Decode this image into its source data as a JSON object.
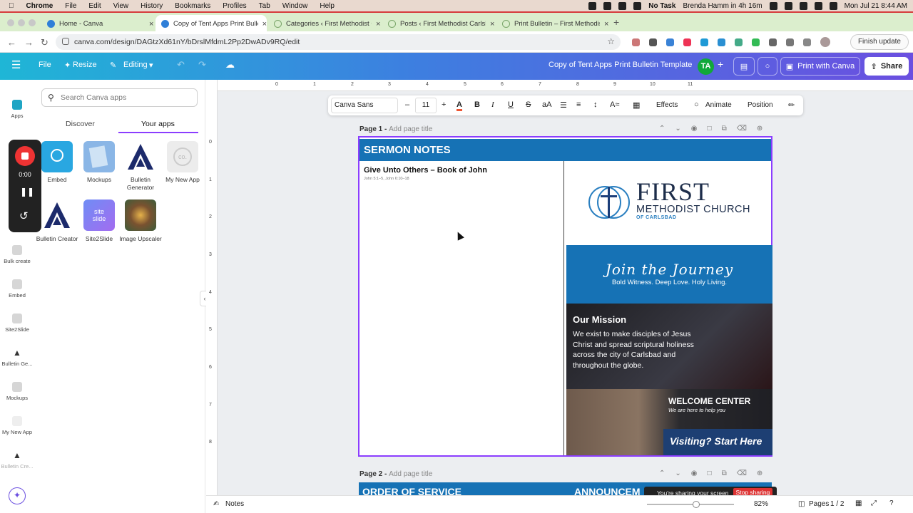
{
  "menubar": {
    "app": "Chrome",
    "items": [
      "File",
      "Edit",
      "View",
      "History",
      "Bookmarks",
      "Profiles",
      "Tab",
      "Window",
      "Help"
    ],
    "no_task": "No Task",
    "reminder": "Brenda Hamm in 4h 16m",
    "clock": "Mon Jul 21  8:44 AM"
  },
  "tabs": [
    {
      "title": "Home - Canva",
      "color": "#2f7fd8"
    },
    {
      "title": "Copy of Tent Apps Print Bulle",
      "color": "#2f7fd8"
    },
    {
      "title": "Categories ‹ First Methodist C",
      "color": "#7aa66a"
    },
    {
      "title": "Posts ‹ First Methodist Carlsb",
      "color": "#7aa66a"
    },
    {
      "title": "Print Bulletin – First Methodis",
      "color": "#7aa66a"
    }
  ],
  "address": {
    "url": "canva.com/design/DAGtzXd61nY/bDrslMfdmL2Pp2DwADv9RQ/edit",
    "finish_update": "Finish update"
  },
  "canva_header": {
    "file": "File",
    "resize": "Resize",
    "editing": "Editing",
    "design_title": "Copy of Tent Apps Print Bulletin Template",
    "avatar": "TA",
    "print": "Print with Canva",
    "share": "Share"
  },
  "rail": [
    "Apps",
    "Ma",
    "Ba",
    "Bulk create",
    "Embed",
    "Site2Slide",
    "Bulletin Ge...",
    "Mockups",
    "My New App",
    "Bulletin Cre..."
  ],
  "panel": {
    "search_placeholder": "Search Canva apps",
    "tab_discover": "Discover",
    "tab_your_apps": "Your apps",
    "apps": [
      {
        "label": "Embed",
        "color": "#29a7e1"
      },
      {
        "label": "Mockups",
        "color": "#8ab6e6"
      },
      {
        "label": "Bulletin Generator",
        "color": "#ffffff"
      },
      {
        "label": "My New App",
        "color": "#e9e9e9"
      },
      {
        "label": "Bulletin Creator",
        "color": "#ffffff"
      },
      {
        "label": "Site2Slide",
        "color": "#8d6cf0"
      },
      {
        "label": "Image Upscaler",
        "color": "#4b5b3c"
      }
    ]
  },
  "recorder": {
    "time": "0:00"
  },
  "ruler": {
    "top": [
      "0",
      "1",
      "2",
      "3",
      "4",
      "5",
      "6",
      "7",
      "8",
      "9",
      "10",
      "11"
    ],
    "left": [
      "0",
      "1",
      "2",
      "3",
      "4",
      "5",
      "6",
      "7",
      "8"
    ]
  },
  "format_bar": {
    "font": "Canva Sans",
    "minus": "–",
    "size": "11",
    "plus": "+",
    "effects": "Effects",
    "animate": "Animate",
    "position": "Position"
  },
  "page1": {
    "label": "Page 1 -",
    "add_title": "Add page title",
    "band": "SERMON NOTES",
    "sermon_title": "Give Unto Others – Book of John",
    "scripture": "John 5:1–5, John 6:10–18",
    "church_first": "FIRST",
    "church_name": "METHODIST CHURCH",
    "church_sub": "OF CARLSBAD",
    "join": "Join the Journey",
    "tagline": "Bold Witness. Deep Love. Holy Living.",
    "mission_title": "Our Mission",
    "mission_text": "We exist to make disciples of Jesus Christ and spread scriptural holiness across the city of Carlsbad and throughout the globe.",
    "welcome": "WELCOME CENTER",
    "welcome_sub": "We are here to help you",
    "visiting": "Visiting? Start Here"
  },
  "page2": {
    "label": "Page 2 -",
    "add_title": "Add page title",
    "band_left": "ORDER OF SERVICE",
    "band_right": "ANNOUNCEM"
  },
  "bottom": {
    "notes": "Notes",
    "zoom": "82%",
    "pages": "Pages",
    "page_count": "1 / 2"
  },
  "sharing": {
    "text": "You're sharing your screen",
    "stop": "Stop sharing"
  }
}
